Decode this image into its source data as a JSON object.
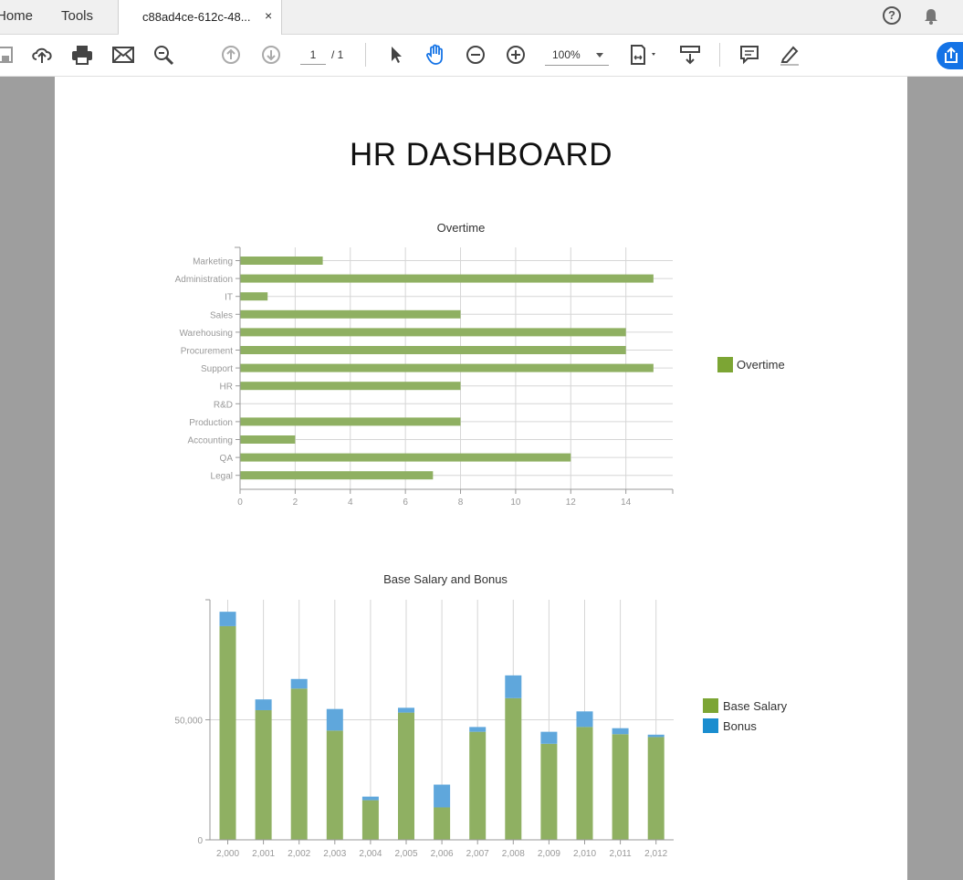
{
  "tabs": {
    "home": "Home",
    "tools": "Tools",
    "document": "c88ad4ce-612c-48...",
    "close": "×"
  },
  "header_icons": {
    "help": "?",
    "help_icon": "help-circle-icon",
    "notifications_icon": "bell-icon"
  },
  "toolbar": {
    "icons": [
      "save-icon",
      "upload-cloud-icon",
      "print-icon",
      "email-icon",
      "search-zoom-icon",
      "page-up-icon",
      "page-down-icon",
      "select-arrow-icon",
      "hand-tool-icon",
      "zoom-out-icon",
      "zoom-in-icon",
      "fit-page-icon",
      "scroll-mode-icon",
      "comment-icon",
      "highlight-pen-icon",
      "share-icon"
    ],
    "page_current": "1",
    "page_total": "/ 1",
    "zoom": "100%"
  },
  "document": {
    "title": "HR DASHBOARD",
    "colors": {
      "base": "#8fb062",
      "bonus": "#5fa7dc",
      "legend_base": "#7ca534",
      "legend_bonus": "#1a8dcf"
    }
  },
  "chart_data": [
    {
      "type": "bar",
      "orientation": "horizontal",
      "title": "Overtime",
      "categories": [
        "Marketing",
        "Administration",
        "IT",
        "Sales",
        "Warehousing",
        "Procurement",
        "Support",
        "HR",
        "R&D",
        "Production",
        "Accounting",
        "QA",
        "Legal"
      ],
      "series": [
        {
          "name": "Overtime",
          "values": [
            3,
            15,
            1,
            8,
            14,
            14,
            15,
            8,
            0,
            8,
            2,
            12,
            7
          ]
        }
      ],
      "xlim": [
        0,
        15.7
      ],
      "xticks": [
        "0",
        "2",
        "4",
        "6",
        "8",
        "10",
        "12",
        "14"
      ],
      "grid": true,
      "legend": "right"
    },
    {
      "type": "bar",
      "stacked": true,
      "title": "Base Salary and Bonus",
      "categories": [
        "2,000",
        "2,001",
        "2,002",
        "2,003",
        "2,004",
        "2,005",
        "2,006",
        "2,007",
        "2,008",
        "2,009",
        "2,010",
        "2,011",
        "2,012"
      ],
      "series": [
        {
          "name": "Base Salary",
          "values": [
            89000,
            54000,
            63000,
            45500,
            16500,
            53000,
            13500,
            45000,
            59000,
            40000,
            47000,
            44000,
            42800
          ]
        },
        {
          "name": "Bonus",
          "values": [
            6000,
            4500,
            4000,
            9000,
            1500,
            2000,
            9500,
            2000,
            9500,
            5000,
            6500,
            2500,
            1000
          ]
        }
      ],
      "ylim": [
        0,
        100000
      ],
      "yticks": [
        "0",
        "50,000"
      ],
      "grid": true,
      "legend": "right"
    }
  ]
}
